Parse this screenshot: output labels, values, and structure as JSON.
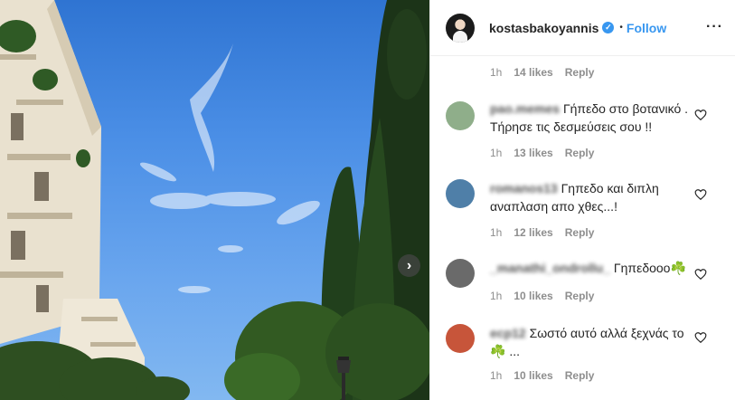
{
  "post": {
    "username": "kostasbakoyannis",
    "verified_mark": "✓",
    "separator": "•",
    "follow_label": "Follow",
    "more_label": "···",
    "carousel_next": "›"
  },
  "top_meta": {
    "time": "1h",
    "likes": "14 likes",
    "reply": "Reply"
  },
  "comments": [
    {
      "user": "pao.memes",
      "text": "Γήπεδο στο βοτανικό . Τήρησε τις δεσμεύσεις σου !!",
      "time": "1h",
      "likes": "13 likes",
      "reply": "Reply",
      "avatar_color": "#8fae8a"
    },
    {
      "user": "romanos13",
      "text": "Γηπεδο και διπλη αναπλαση απο χθες...!",
      "time": "1h",
      "likes": "12 likes",
      "reply": "Reply",
      "avatar_color": "#4f7fa8"
    },
    {
      "user": "_manathi_ondrollu_",
      "text": "Γηπεδοοο☘️",
      "time": "1h",
      "likes": "10 likes",
      "reply": "Reply",
      "avatar_color": "#6a6a6a"
    },
    {
      "user": "ecp12",
      "text": "Σωστό αυτό αλλά ξεχνάς το ☘️ ...",
      "time": "1h",
      "likes": "10 likes",
      "reply": "Reply",
      "avatar_color": "#c7553a"
    }
  ],
  "icons": {
    "heart": "heart-outline-icon",
    "verified": "verified-badge-icon",
    "carousel": "chevron-right-icon"
  },
  "colors": {
    "accent": "#3897f0",
    "muted": "#8e8e8e",
    "text": "#262626"
  }
}
